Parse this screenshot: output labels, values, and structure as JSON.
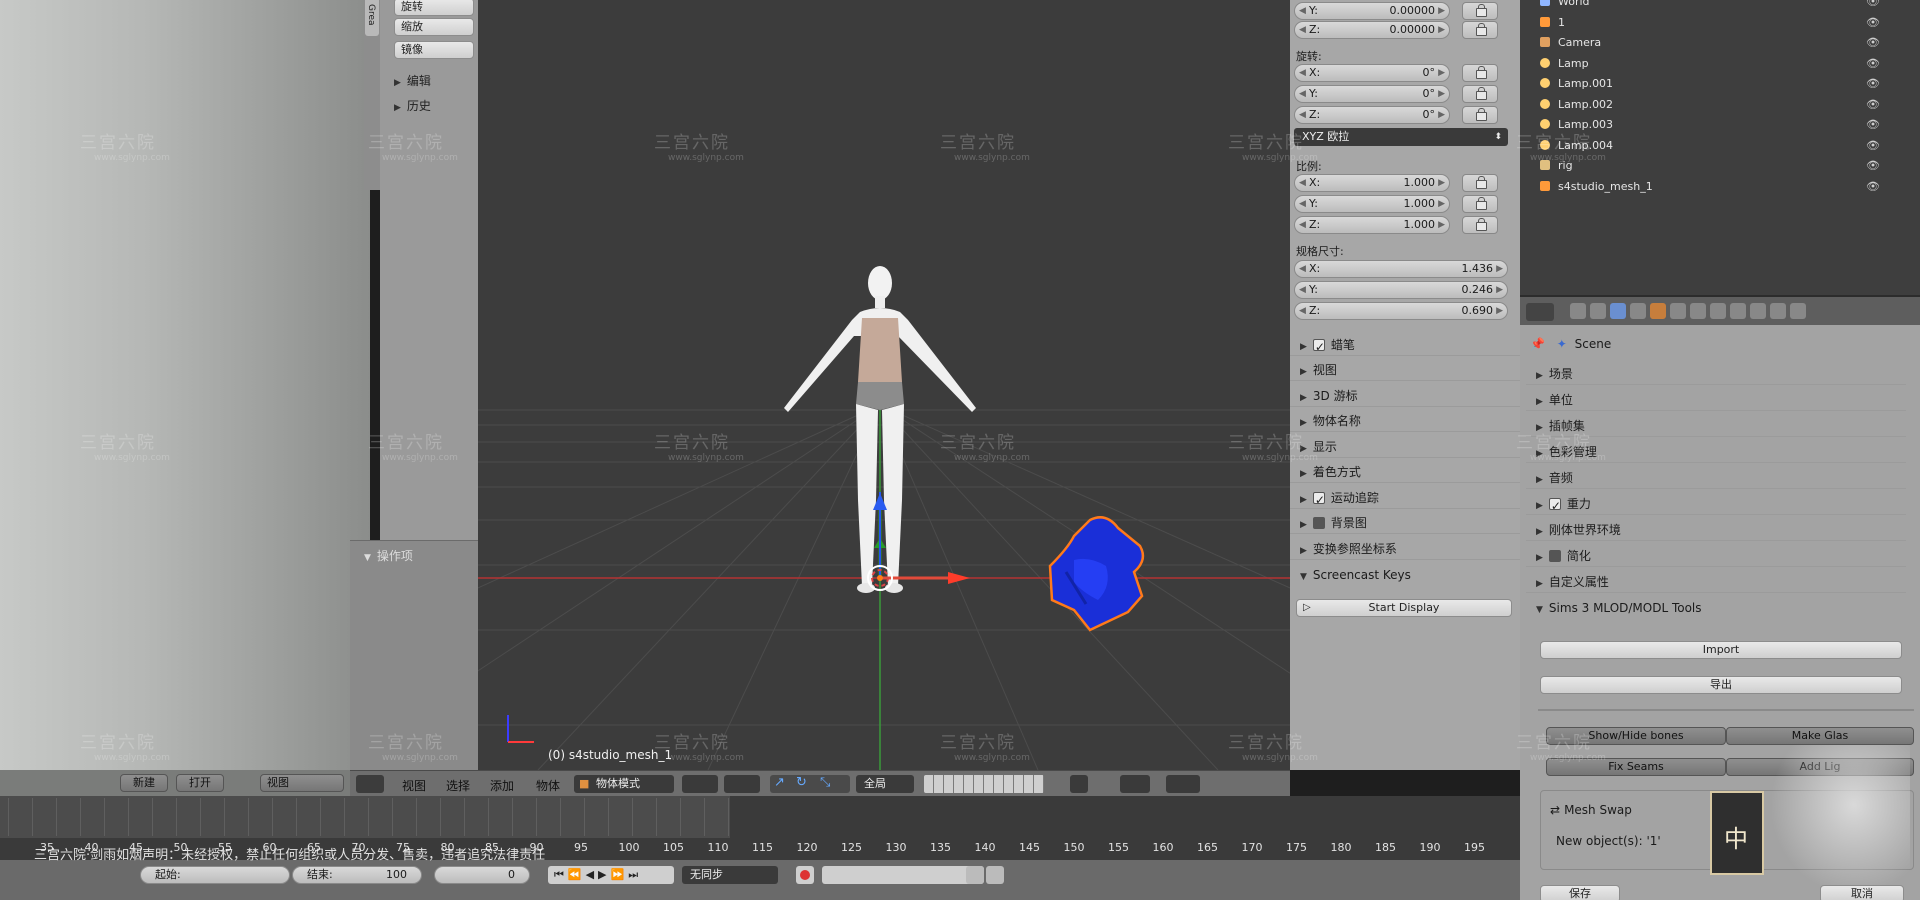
{
  "toolshelf": {
    "tabs": [
      "Grea"
    ],
    "buttons": [
      "旋转",
      "缩放",
      "镜像"
    ],
    "sections": [
      "编辑",
      "历史"
    ],
    "operator_panel": "操作项"
  },
  "n_panel": {
    "location": {
      "y": "0.00000",
      "z": "0.00000"
    },
    "rotation_label": "旋转:",
    "rotation": {
      "x": "0°",
      "y": "0°",
      "z": "0°"
    },
    "rotation_mode": "XYZ 欧拉",
    "scale_label": "比例:",
    "scale": {
      "x": "1.000",
      "y": "1.000",
      "z": "1.000"
    },
    "dimensions_label": "规格尺寸:",
    "dimensions": {
      "x": "1.436",
      "y": "0.246",
      "z": "0.690"
    },
    "axis": {
      "x": "X:",
      "y": "Y:",
      "z": "Z:"
    },
    "panels": [
      {
        "label": "蜡笔",
        "check": "on"
      },
      {
        "label": "视图",
        "check": "none"
      },
      {
        "label": "3D 游标",
        "check": "none"
      },
      {
        "label": "物体名称",
        "check": "none"
      },
      {
        "label": "显示",
        "check": "none"
      },
      {
        "label": "着色方式",
        "check": "none"
      },
      {
        "label": "运动追踪",
        "check": "on"
      },
      {
        "label": "背景图",
        "check": "off"
      },
      {
        "label": "变换参照坐标系",
        "check": "none"
      }
    ],
    "screencast": {
      "label": "Screencast Keys",
      "button": "Start Display"
    }
  },
  "outliner": {
    "items": [
      {
        "label": "World",
        "icon": "world-icon"
      },
      {
        "label": "1",
        "icon": "mesh-icon"
      },
      {
        "label": "Camera",
        "icon": "camera-icon"
      },
      {
        "label": "Lamp",
        "icon": "lamp-icon"
      },
      {
        "label": "Lamp.001",
        "icon": "lamp-icon"
      },
      {
        "label": "Lamp.002",
        "icon": "lamp-icon"
      },
      {
        "label": "Lamp.003",
        "icon": "lamp-icon"
      },
      {
        "label": "Lamp.004",
        "icon": "lamp-icon"
      },
      {
        "label": "rig",
        "icon": "armature-icon"
      },
      {
        "label": "s4studio_mesh_1",
        "icon": "mesh-icon"
      }
    ]
  },
  "properties": {
    "scene_label": "Scene",
    "panels": [
      {
        "label": "场景",
        "check": "none"
      },
      {
        "label": "单位",
        "check": "none"
      },
      {
        "label": "插帧集",
        "check": "none"
      },
      {
        "label": "色彩管理",
        "check": "none"
      },
      {
        "label": "音频",
        "check": "none"
      },
      {
        "label": "重力",
        "check": "on"
      },
      {
        "label": "刚体世界环境",
        "check": "none"
      },
      {
        "label": "简化",
        "check": "off"
      },
      {
        "label": "自定义属性",
        "check": "none"
      }
    ],
    "sims": {
      "title": "Sims 3 MLOD/MODL Tools",
      "import": "Import",
      "export": "导出",
      "show_hide_bones": "Show/Hide bones",
      "make_glass": "Make Glas",
      "fix_seams": "Fix Seams",
      "add_lights": "Add Lig"
    },
    "mesh_swap": {
      "title": "Mesh Swap",
      "new_objects": "New object(s): '1'"
    }
  },
  "viewport": {
    "object_label": "(0) s4studio_mesh_1"
  },
  "header_3d": {
    "menus": [
      "视图",
      "选择",
      "添加",
      "物体"
    ],
    "mode": "物体模式",
    "orientation": "全局"
  },
  "left_header": {
    "buttons": [
      "新建",
      "打开"
    ],
    "view": "视图"
  },
  "timeline": {
    "ticks": [
      "35",
      "40",
      "45",
      "50",
      "55",
      "60",
      "65",
      "70",
      "75",
      "80",
      "85",
      "90",
      "95",
      "100",
      "105",
      "110",
      "115",
      "120",
      "125",
      "130",
      "135",
      "140",
      "145",
      "150",
      "155",
      "160",
      "165",
      "170",
      "175",
      "180",
      "185",
      "190",
      "195"
    ],
    "start_label": "起始:",
    "end_label": "结束:",
    "end_value": "100",
    "current": "0",
    "sync": "无同步"
  },
  "props_footer": {
    "left": "保存",
    "right": "取消"
  },
  "watermark": {
    "brand": "三宫六院",
    "url": "www.sglynp.com",
    "notice": "三宫六院·剑雨如烟声明：未经授权，禁止任何组织或人员分发、售卖，违者追究法律责任",
    "seal": "中"
  },
  "colors": {
    "mesh_blue": "#1a2fd8",
    "selection_orange": "#ff7a1a",
    "x_axis": "#d42a2a",
    "y_axis": "#2ab52a"
  }
}
